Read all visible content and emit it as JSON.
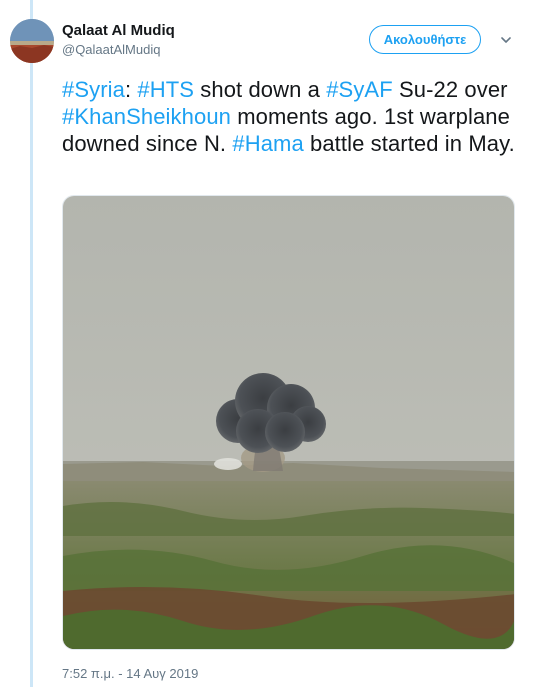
{
  "author": {
    "name": "Qalaat Al Mudiq",
    "handle": "@QalaatAlMudiq"
  },
  "follow_button_label": "Ακολουθήστε",
  "icons": {
    "more": "chevron-down-icon",
    "avatar": "avatar-image"
  },
  "tweet": {
    "segments": [
      {
        "text": "#Syria",
        "type": "hashtag"
      },
      {
        "text": ": ",
        "type": "text"
      },
      {
        "text": "#HTS",
        "type": "hashtag"
      },
      {
        "text": " shot down a ",
        "type": "text"
      },
      {
        "text": "#SyAF",
        "type": "hashtag"
      },
      {
        "text": " Su-22 over ",
        "type": "text"
      },
      {
        "text": "#KhanSheikhoun",
        "type": "hashtag"
      },
      {
        "text": " moments ago. 1st warplane downed since N. ",
        "type": "text"
      },
      {
        "text": "#Hama",
        "type": "hashtag"
      },
      {
        "text": " battle started in May.",
        "type": "text"
      }
    ],
    "timestamp": "7:52 π.μ. - 14 Αυγ 2019"
  },
  "colors": {
    "link": "#1da1f2",
    "text": "#14171a",
    "muted": "#657786",
    "thread_line": "#cde6f7"
  }
}
